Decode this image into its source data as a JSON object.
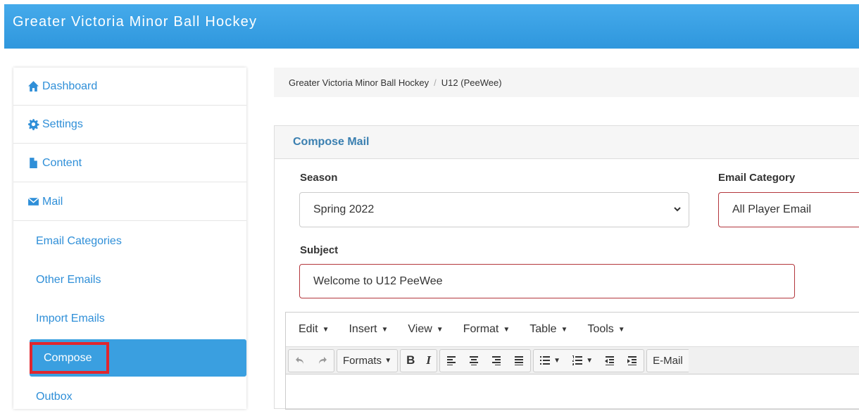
{
  "app": {
    "title": "Greater Victoria Minor Ball Hockey"
  },
  "sidebar": {
    "items": [
      {
        "label": "Dashboard",
        "icon": "home-icon"
      },
      {
        "label": "Settings",
        "icon": "gear-icon"
      },
      {
        "label": "Content",
        "icon": "file-icon"
      },
      {
        "label": "Mail",
        "icon": "envelope-icon"
      }
    ],
    "mail_subitems": [
      "Email Categories",
      "Other Emails",
      "Import Emails",
      "Compose",
      "Outbox"
    ],
    "active_item": "Compose"
  },
  "breadcrumb": {
    "items": [
      "Greater Victoria Minor Ball Hockey",
      "U12 (PeeWee)"
    ],
    "separator": "/"
  },
  "compose": {
    "panel_title": "Compose Mail",
    "season_label": "Season",
    "season_value": "Spring 2022",
    "category_label": "Email Category",
    "category_value": "All Player Email",
    "subject_label": "Subject",
    "subject_value": "Welcome to U12 PeeWee"
  },
  "editor": {
    "menus": [
      "Edit",
      "Insert",
      "View",
      "Format",
      "Table",
      "Tools"
    ],
    "formats_label": "Formats",
    "bold_label": "B",
    "italic_label": "I",
    "email_label": "E-Mail"
  },
  "colors": {
    "header": "#3aa0e6",
    "link": "#2f8fd8",
    "active": "#3a9fe0",
    "highlight_outline": "#e0262e",
    "error_border": "#b3363c"
  }
}
